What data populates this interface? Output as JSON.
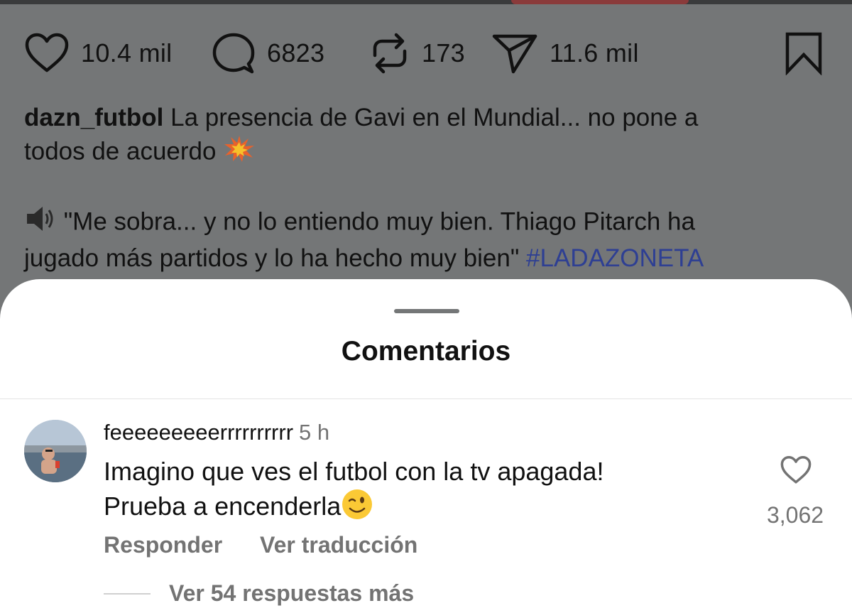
{
  "post_actions": {
    "likes": "10.4 mil",
    "comments": "6823",
    "reposts": "173",
    "shares": "11.6 mil"
  },
  "caption": {
    "username": "dazn_futbol",
    "text_1": "La presencia de Gavi en el Mundial... no pone a",
    "text_2": "todos de acuerdo",
    "quote_1": "\"Me sobra... y no lo entiendo muy bien. Thiago Pitarch ha",
    "quote_2": "jugado más partidos y lo ha hecho muy bien\"",
    "hashtag": "#LADAZONETA"
  },
  "comments_sheet": {
    "title": "Comentarios",
    "comment": {
      "username": "feeeeeeeeerrrrrrrrrr",
      "time": "5 h",
      "text_1": "Imagino que ves el futbol con la tv apagada!",
      "text_2": "Prueba a encenderla",
      "like_count": "3,062",
      "reply_label": "Responder",
      "translate_label": "Ver traducción",
      "more_replies_label": "Ver 54 respuestas más"
    }
  },
  "icons": {
    "like": "heart-icon",
    "comment": "speech-bubble-icon",
    "repost": "repost-arrows-icon",
    "share": "paper-plane-icon",
    "save": "bookmark-icon",
    "collision_emoji": "collision-emoji",
    "speaker_emoji": "speaker-emoji",
    "wink_emoji": "winking-face-emoji"
  },
  "colors": {
    "hashtag": "#2e3f93",
    "muted_text": "#737373",
    "overlay": "#747677"
  }
}
